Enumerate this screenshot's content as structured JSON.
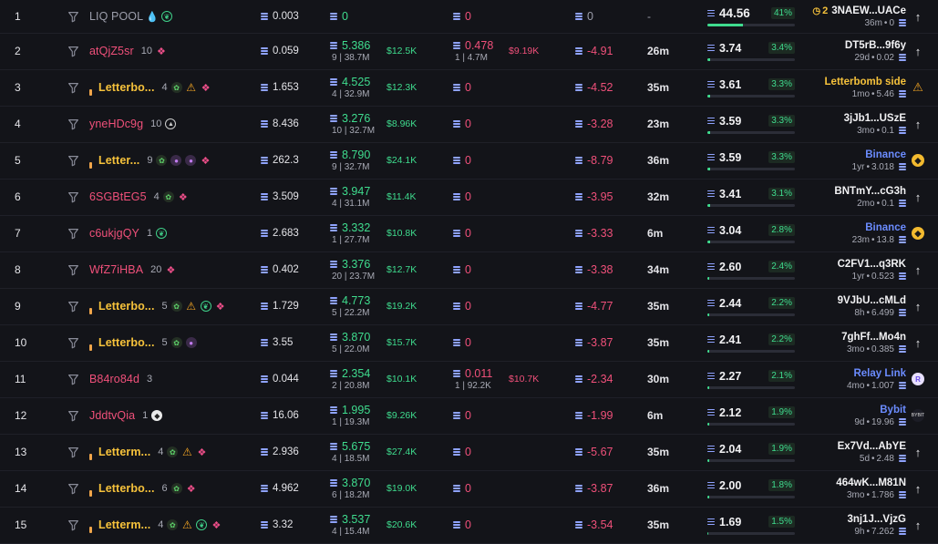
{
  "rows": [
    {
      "rank": "1",
      "name": "LIQ POOL",
      "name_style": "grey",
      "dot": false,
      "count": "",
      "icons": [
        "drop",
        "leaf"
      ],
      "balance": "0.003",
      "buy": "0",
      "buy_sub": "",
      "buy_usd": "",
      "sell": "0",
      "sell_sub": "",
      "sell_usd": "",
      "pnl": "0",
      "pnl_zero": true,
      "time": "-",
      "hold_amt": "44.56",
      "hold_pct": "41%",
      "hold_fill": 0.41,
      "src_name": "3NAEW...UACe",
      "src_prefix": "2",
      "src_style": "white",
      "src_meta": "36m",
      "src_meta2": "0",
      "src_icon": "arrow"
    },
    {
      "rank": "2",
      "name": "atQjZ5sr",
      "name_style": "pink",
      "dot": false,
      "count": "10",
      "icons": [
        "layers"
      ],
      "balance": "0.059",
      "buy": "5.386",
      "buy_sub": "9 | 38.7M",
      "buy_usd": "$12.5K",
      "sell": "0.478",
      "sell_sub": "1 | 4.7M",
      "sell_usd": "$9.19K",
      "pnl": "-4.91",
      "pnl_zero": false,
      "time": "26m",
      "hold_amt": "3.74",
      "hold_pct": "3.4%",
      "hold_fill": 0.034,
      "src_name": "DT5rB...9f6y",
      "src_style": "white",
      "src_meta": "29d",
      "src_meta2": "0.02",
      "src_icon": "arrow"
    },
    {
      "rank": "3",
      "name": "Letterbo...",
      "name_style": "gold",
      "dot": true,
      "count": "4",
      "icons": [
        "frog",
        "warn",
        "layers"
      ],
      "balance": "1.653",
      "buy": "4.525",
      "buy_sub": "4 | 32.9M",
      "buy_usd": "$12.3K",
      "sell": "0",
      "sell_sub": "",
      "sell_usd": "",
      "pnl": "-4.52",
      "pnl_zero": false,
      "time": "35m",
      "hold_amt": "3.61",
      "hold_pct": "3.3%",
      "hold_fill": 0.033,
      "src_name": "Letterbomb side",
      "src_style": "gold",
      "src_meta": "1mo",
      "src_meta2": "5.46",
      "src_icon": "warn"
    },
    {
      "rank": "4",
      "name": "yneHDc9g",
      "name_style": "pink",
      "dot": false,
      "count": "10",
      "icons": [
        "tri"
      ],
      "balance": "8.436",
      "buy": "3.276",
      "buy_sub": "10 | 32.7M",
      "buy_usd": "$8.96K",
      "sell": "0",
      "sell_sub": "",
      "sell_usd": "",
      "pnl": "-3.28",
      "pnl_zero": false,
      "time": "23m",
      "hold_amt": "3.59",
      "hold_pct": "3.3%",
      "hold_fill": 0.033,
      "src_name": "3jJb1...USzE",
      "src_style": "white",
      "src_meta": "3mo",
      "src_meta2": "0.1",
      "src_icon": "arrow"
    },
    {
      "rank": "5",
      "name": "Letter...",
      "name_style": "gold",
      "dot": true,
      "count": "9",
      "icons": [
        "frog",
        "bomb",
        "bomb",
        "layers"
      ],
      "balance": "262.3",
      "buy": "8.790",
      "buy_sub": "9 | 32.7M",
      "buy_usd": "$24.1K",
      "sell": "0",
      "sell_sub": "",
      "sell_usd": "",
      "pnl": "-8.79",
      "pnl_zero": false,
      "time": "36m",
      "hold_amt": "3.59",
      "hold_pct": "3.3%",
      "hold_fill": 0.033,
      "src_name": "Binance",
      "src_style": "blue",
      "src_meta": "1yr",
      "src_meta2": "3.018",
      "src_icon": "bnb"
    },
    {
      "rank": "6",
      "name": "6SGBtEG5",
      "name_style": "pink",
      "dot": false,
      "count": "4",
      "icons": [
        "frog",
        "layers"
      ],
      "balance": "3.509",
      "buy": "3.947",
      "buy_sub": "4 | 31.1M",
      "buy_usd": "$11.4K",
      "sell": "0",
      "sell_sub": "",
      "sell_usd": "",
      "pnl": "-3.95",
      "pnl_zero": false,
      "time": "32m",
      "hold_amt": "3.41",
      "hold_pct": "3.1%",
      "hold_fill": 0.031,
      "src_name": "BNTmY...cG3h",
      "src_style": "white",
      "src_meta": "2mo",
      "src_meta2": "0.1",
      "src_icon": "arrow"
    },
    {
      "rank": "7",
      "name": "c6ukjgQY",
      "name_style": "pink",
      "dot": false,
      "count": "1",
      "icons": [
        "leaf"
      ],
      "balance": "2.683",
      "buy": "3.332",
      "buy_sub": "1 | 27.7M",
      "buy_usd": "$10.8K",
      "sell": "0",
      "sell_sub": "",
      "sell_usd": "",
      "pnl": "-3.33",
      "pnl_zero": false,
      "time": "6m",
      "hold_amt": "3.04",
      "hold_pct": "2.8%",
      "hold_fill": 0.028,
      "src_name": "Binance",
      "src_style": "blue",
      "src_meta": "23m",
      "src_meta2": "13.8",
      "src_icon": "bnb"
    },
    {
      "rank": "8",
      "name": "WfZ7iHBA",
      "name_style": "pink",
      "dot": false,
      "count": "20",
      "icons": [
        "layers"
      ],
      "balance": "0.402",
      "buy": "3.376",
      "buy_sub": "20 | 23.7M",
      "buy_usd": "$12.7K",
      "sell": "0",
      "sell_sub": "",
      "sell_usd": "",
      "pnl": "-3.38",
      "pnl_zero": false,
      "time": "34m",
      "hold_amt": "2.60",
      "hold_pct": "2.4%",
      "hold_fill": 0.024,
      "src_name": "C2FV1...q3RK",
      "src_style": "white",
      "src_meta": "1yr",
      "src_meta2": "0.523",
      "src_icon": "arrow"
    },
    {
      "rank": "9",
      "name": "Letterbo...",
      "name_style": "gold",
      "dot": true,
      "count": "5",
      "icons": [
        "frog",
        "warn",
        "leaf",
        "layers"
      ],
      "balance": "1.729",
      "buy": "4.773",
      "buy_sub": "5 | 22.2M",
      "buy_usd": "$19.2K",
      "sell": "0",
      "sell_sub": "",
      "sell_usd": "",
      "pnl": "-4.77",
      "pnl_zero": false,
      "time": "35m",
      "hold_amt": "2.44",
      "hold_pct": "2.2%",
      "hold_fill": 0.022,
      "src_name": "9VJbU...cMLd",
      "src_style": "white",
      "src_meta": "8h",
      "src_meta2": "6.499",
      "src_icon": "arrow"
    },
    {
      "rank": "10",
      "name": "Letterbo...",
      "name_style": "gold",
      "dot": true,
      "count": "5",
      "icons": [
        "frog",
        "bomb"
      ],
      "balance": "3.55",
      "buy": "3.870",
      "buy_sub": "5 | 22.0M",
      "buy_usd": "$15.7K",
      "sell": "0",
      "sell_sub": "",
      "sell_usd": "",
      "pnl": "-3.87",
      "pnl_zero": false,
      "time": "35m",
      "hold_amt": "2.41",
      "hold_pct": "2.2%",
      "hold_fill": 0.022,
      "src_name": "7ghFf...Mo4n",
      "src_style": "white",
      "src_meta": "3mo",
      "src_meta2": "0.385",
      "src_icon": "arrow"
    },
    {
      "rank": "11",
      "name": "B84ro84d",
      "name_style": "pink",
      "dot": false,
      "count": "3",
      "icons": [],
      "balance": "0.044",
      "buy": "2.354",
      "buy_sub": "2 | 20.8M",
      "buy_usd": "$10.1K",
      "sell": "0.011",
      "sell_sub": "1 | 92.2K",
      "sell_usd": "$10.7K",
      "pnl": "-2.34",
      "pnl_zero": false,
      "time": "30m",
      "hold_amt": "2.27",
      "hold_pct": "2.1%",
      "hold_fill": 0.021,
      "src_name": "Relay Link",
      "src_style": "blue",
      "src_meta": "4mo",
      "src_meta2": "1.007",
      "src_icon": "relay"
    },
    {
      "rank": "12",
      "name": "JddtvQia",
      "name_style": "pink",
      "dot": false,
      "count": "1",
      "icons": [
        "ghost"
      ],
      "balance": "16.06",
      "buy": "1.995",
      "buy_sub": "1 | 19.3M",
      "buy_usd": "$9.26K",
      "sell": "0",
      "sell_sub": "",
      "sell_usd": "",
      "pnl": "-1.99",
      "pnl_zero": false,
      "time": "6m",
      "hold_amt": "2.12",
      "hold_pct": "1.9%",
      "hold_fill": 0.019,
      "src_name": "Bybit",
      "src_style": "blue",
      "src_meta": "9d",
      "src_meta2": "19.96",
      "src_icon": "bybit"
    },
    {
      "rank": "13",
      "name": "Letterm...",
      "name_style": "gold",
      "dot": true,
      "count": "4",
      "icons": [
        "frog",
        "warn",
        "layers"
      ],
      "balance": "2.936",
      "buy": "5.675",
      "buy_sub": "4 | 18.5M",
      "buy_usd": "$27.4K",
      "sell": "0",
      "sell_sub": "",
      "sell_usd": "",
      "pnl": "-5.67",
      "pnl_zero": false,
      "time": "35m",
      "hold_amt": "2.04",
      "hold_pct": "1.9%",
      "hold_fill": 0.019,
      "src_name": "Ex7Vd...AbYE",
      "src_style": "white",
      "src_meta": "5d",
      "src_meta2": "2.48",
      "src_icon": "arrow"
    },
    {
      "rank": "14",
      "name": "Letterbo...",
      "name_style": "gold",
      "dot": true,
      "count": "6",
      "icons": [
        "frog",
        "layers"
      ],
      "balance": "4.962",
      "buy": "3.870",
      "buy_sub": "6 | 18.2M",
      "buy_usd": "$19.0K",
      "sell": "0",
      "sell_sub": "",
      "sell_usd": "",
      "pnl": "-3.87",
      "pnl_zero": false,
      "time": "36m",
      "hold_amt": "2.00",
      "hold_pct": "1.8%",
      "hold_fill": 0.018,
      "src_name": "464wK...M81N",
      "src_style": "white",
      "src_meta": "3mo",
      "src_meta2": "1.786",
      "src_icon": "arrow"
    },
    {
      "rank": "15",
      "name": "Letterm...",
      "name_style": "gold",
      "dot": true,
      "count": "4",
      "icons": [
        "frog",
        "warn",
        "leaf",
        "layers"
      ],
      "balance": "3.32",
      "buy": "3.537",
      "buy_sub": "4 | 15.4M",
      "buy_usd": "$20.6K",
      "sell": "0",
      "sell_sub": "",
      "sell_usd": "",
      "pnl": "-3.54",
      "pnl_zero": false,
      "time": "35m",
      "hold_amt": "1.69",
      "hold_pct": "1.5%",
      "hold_fill": 0.015,
      "src_name": "3nj1J...VjzG",
      "src_style": "white",
      "src_meta": "9h",
      "src_meta2": "7.262",
      "src_icon": "arrow"
    }
  ],
  "icon_glyphs": {
    "drop": "💧",
    "leaf": "❦",
    "frog": "✿",
    "bomb": "●",
    "warn": "⚠",
    "layers": "❖",
    "ghost": "◆",
    "tri": "▲"
  },
  "colors": {
    "background": "#131419",
    "positive": "#3fdc8e",
    "negative": "#f0507a",
    "accent_gold": "#f6c23b",
    "link_blue": "#6b8cff"
  }
}
